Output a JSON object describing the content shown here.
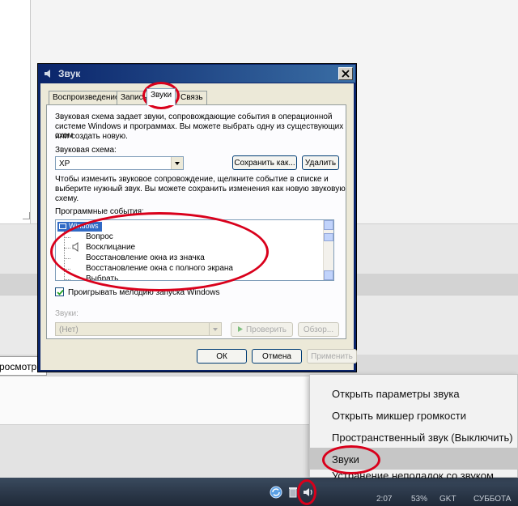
{
  "background": {
    "input_text": "росмотр"
  },
  "dialog": {
    "title": "Звук",
    "tabs": [
      {
        "label": "Воспроизведение"
      },
      {
        "label": "Запись"
      },
      {
        "label": "Звуки"
      },
      {
        "label": "Связь"
      }
    ],
    "active_tab": "Звуки",
    "description": [
      "Звуковая схема задает звуки, сопровождающие события в операционной",
      "системе Windows и программах. Вы можете выбрать одну из существующих схем",
      "или создать новую."
    ],
    "scheme_label": "Звуковая схема:",
    "scheme_value": "XP",
    "save_as_label": "Сохранить как...",
    "delete_label": "Удалить",
    "change_text": [
      "Чтобы изменить звуковое сопровождение, щелкните событие в списке и",
      "выберите нужный звук. Вы можете сохранить изменения как новую звуковую",
      "схему."
    ],
    "events_label": "Программные события:",
    "events": {
      "root": "Windows",
      "items": [
        "Вопрос",
        "Восклицание",
        "Восстановление окна из значка",
        "Восстановление окна с полного экрана",
        "Выбрать"
      ]
    },
    "startup_checkbox_label": "Проигрывать мелодию запуска Windows",
    "startup_checkbox_checked": true,
    "sounds_label": "Звуки:",
    "sound_value": "(Нет)",
    "test_label": "Проверить",
    "browse_label": "Обзор...",
    "ok_label": "ОК",
    "cancel_label": "Отмена",
    "apply_label": "Применить"
  },
  "context_menu": {
    "items": [
      {
        "label": "Открыть параметры звука",
        "highlighted": false
      },
      {
        "label": "Открыть микшер громкости",
        "highlighted": false
      },
      {
        "label": "Пространственный звук (Выключить)",
        "highlighted": false
      },
      {
        "label": "Звуки",
        "highlighted": true
      },
      {
        "label": "Устранение неполадок со звуком",
        "highlighted": false
      }
    ]
  },
  "taskbar": {
    "clock_parts": [
      "2:07",
      "53%",
      "GKT",
      "СУББОТА"
    ]
  },
  "colors": {
    "annotation": "#d9001b",
    "title_bar": "#0a246a",
    "menu_highlight": "#c6c6c6",
    "list_selection": "#316ac5"
  },
  "icons": {
    "title": "speaker-icon",
    "close": "close-icon",
    "list_root": "window-icon",
    "list_item": "speaker-icon",
    "test": "play-icon",
    "tray": [
      "sync-icon",
      "trash-icon",
      "speaker-icon"
    ]
  }
}
